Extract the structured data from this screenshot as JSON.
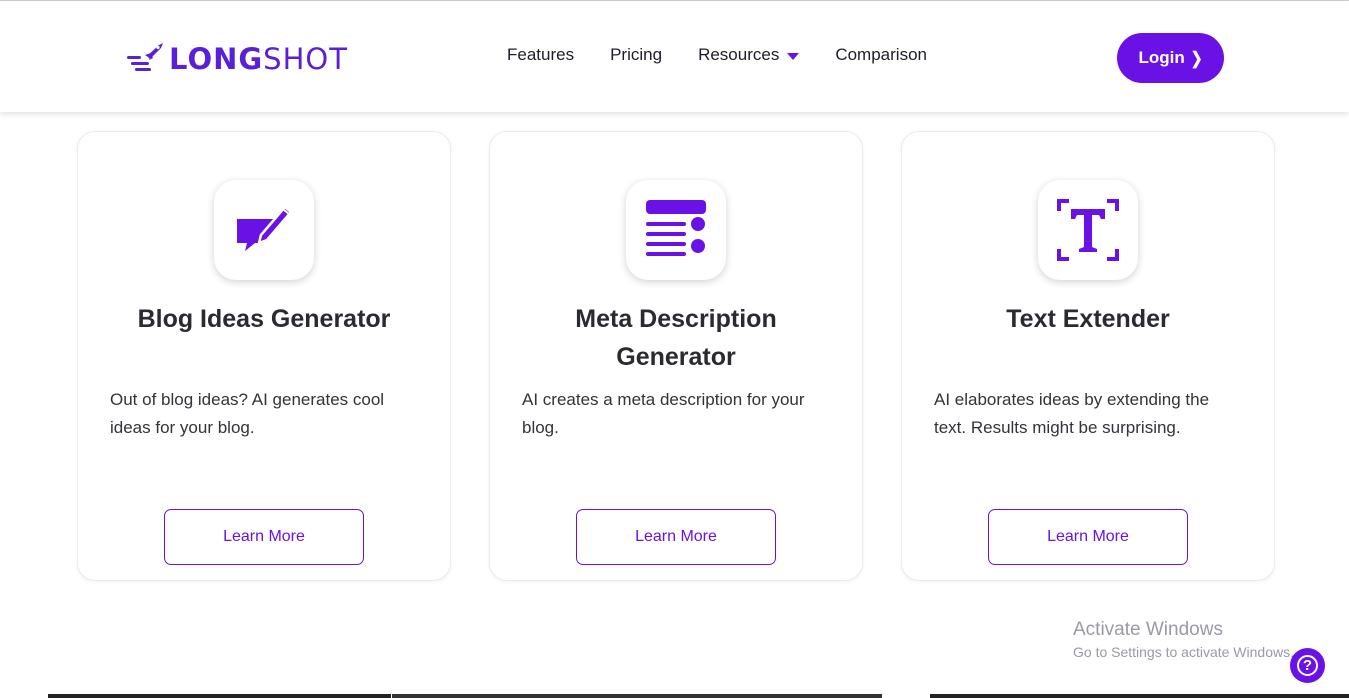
{
  "header": {
    "logo": {
      "brand_bold": "LONG",
      "brand_light": "SHOT",
      "icon": "rocket-lines-icon"
    },
    "nav": [
      {
        "label": "Features"
      },
      {
        "label": "Pricing"
      },
      {
        "label": "Resources",
        "has_dropdown": true
      },
      {
        "label": "Comparison"
      }
    ],
    "login": {
      "label": "Login",
      "icon": "chevron-right-icon"
    }
  },
  "cards": [
    {
      "icon": "edit-message-icon",
      "title": "Blog Ideas Generator",
      "description": "Out of blog ideas? AI generates cool ideas for your blog.",
      "button": "Learn More"
    },
    {
      "icon": "text-lines-icon",
      "title": "Meta Description Generator",
      "description": "AI creates a meta description for your blog.",
      "button": "Learn More"
    },
    {
      "icon": "text-frame-icon",
      "title": "Text Extender",
      "description": "AI elaborates ideas by extending the text. Results might be surprising.",
      "button": "Learn More"
    }
  ],
  "watermark": {
    "line1": "Activate Windows",
    "line2": "Go to Settings to activate Windows."
  },
  "help": {
    "icon": "question-mark-icon",
    "glyph": "?"
  },
  "colors": {
    "accent": "#6a11e6",
    "text": "#222222",
    "background": "#ffffff"
  }
}
